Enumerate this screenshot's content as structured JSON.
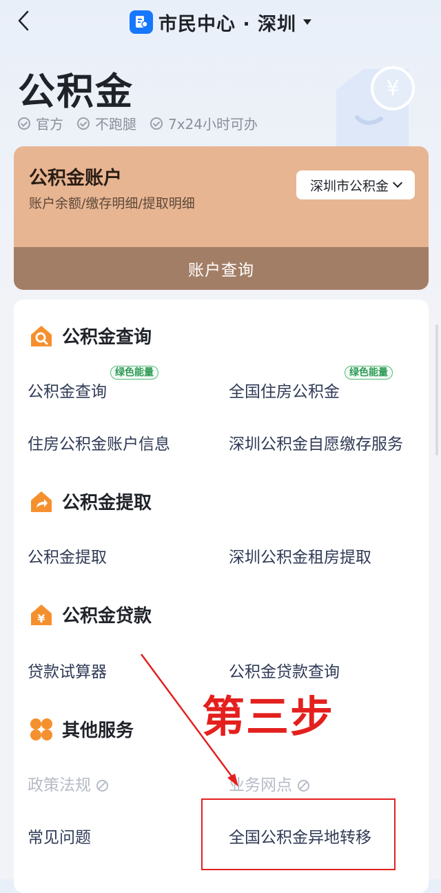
{
  "header": {
    "title": "市民中心 · 深圳"
  },
  "page": {
    "title": "公积金",
    "tags": [
      "官方",
      "不跑腿",
      "7x24小时可办"
    ]
  },
  "account": {
    "title": "公积金账户",
    "subtitle": "账户余额/缴存明细/提取明细",
    "city_select": "深圳市公积金",
    "query_button": "账户查询"
  },
  "sections": {
    "query": {
      "title": "公积金查询",
      "items": [
        "公积金查询",
        "全国住房公积金",
        "住房公积金账户信息",
        "深圳公积金自愿缴存服务"
      ],
      "badge": "绿色能量"
    },
    "withdraw": {
      "title": "公积金提取",
      "items": [
        "公积金提取",
        "深圳公积金租房提取"
      ]
    },
    "loan": {
      "title": "公积金贷款",
      "items": [
        "贷款试算器",
        "公积金贷款查询"
      ]
    },
    "other": {
      "title": "其他服务",
      "items": [
        "政策法规",
        "业务网点",
        "常见问题",
        "全国公积金异地转移"
      ]
    }
  },
  "annotation": {
    "text": "第三步",
    "color": "#e3201e"
  },
  "colors": {
    "brand": "#1677ff",
    "account_card": "#e8b592",
    "account_button": "#a37e66",
    "section_icon": "#f5902f",
    "badge_green": "#2e9a55"
  }
}
